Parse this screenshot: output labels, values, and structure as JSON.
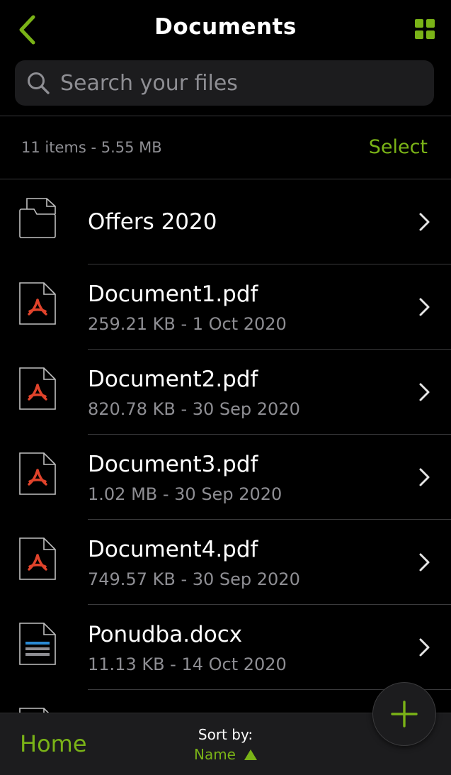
{
  "header": {
    "title": "Documents",
    "back_icon": "chevron-left-icon",
    "grid_icon": "grid-view-icon"
  },
  "search": {
    "placeholder": "Search your files",
    "value": ""
  },
  "summary": {
    "count_text": "11 items - 5.55 MB",
    "select_label": "Select"
  },
  "files": [
    {
      "name": "Offers 2020",
      "meta": "",
      "type": "folder"
    },
    {
      "name": "Document1.pdf",
      "meta": "259.21 KB - 1 Oct 2020",
      "type": "pdf"
    },
    {
      "name": "Document2.pdf",
      "meta": "820.78 KB - 30 Sep 2020",
      "type": "pdf"
    },
    {
      "name": "Document3.pdf",
      "meta": "1.02 MB - 30 Sep 2020",
      "type": "pdf"
    },
    {
      "name": "Document4.pdf",
      "meta": "749.57 KB - 30 Sep 2020",
      "type": "pdf"
    },
    {
      "name": "Ponudba.docx",
      "meta": "11.13 KB - 14 Oct 2020",
      "type": "docx"
    }
  ],
  "bottombar": {
    "home_label": "Home",
    "sort_label": "Sort by:",
    "sort_value": "Name",
    "sort_direction": "ascending"
  },
  "colors": {
    "accent": "#7ab317",
    "background": "#000000",
    "secondary_text": "#8e8e93",
    "pdf_red": "#e0432b",
    "docx_blue": "#2a8ad4"
  }
}
